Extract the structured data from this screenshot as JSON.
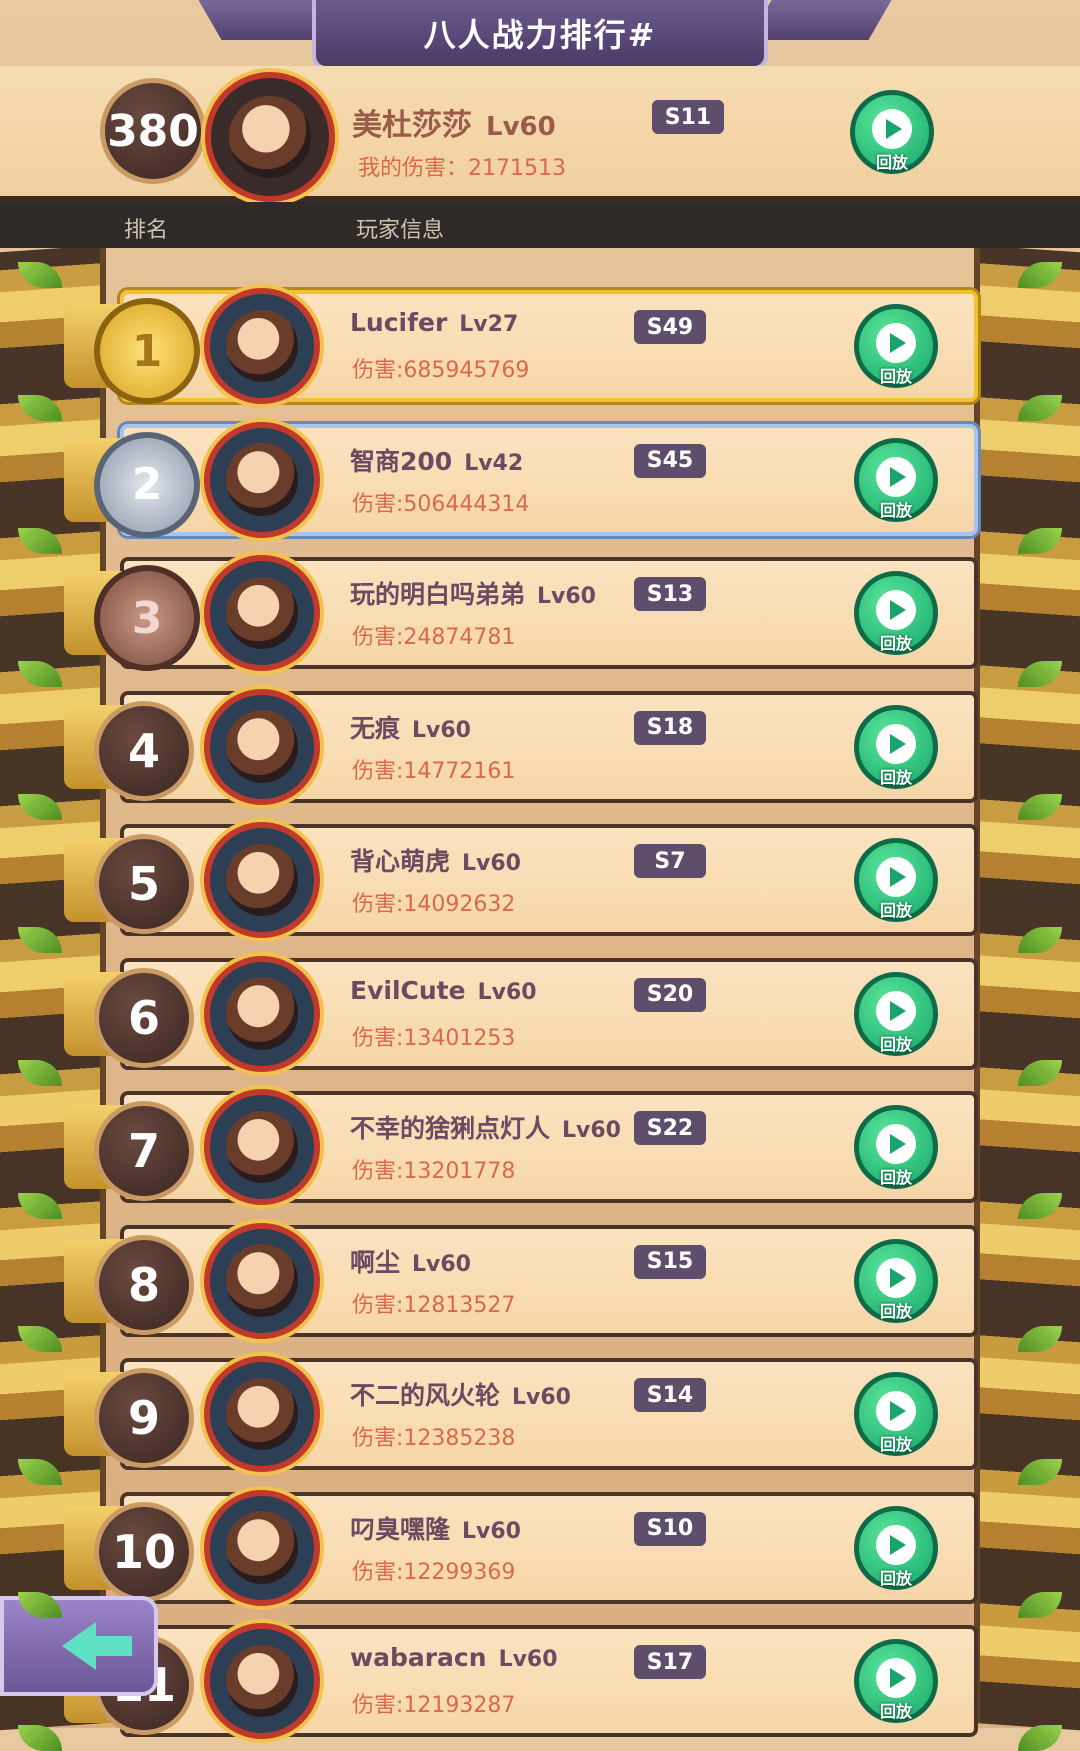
{
  "title": "八人战力排行#",
  "my_entry": {
    "rank": "380",
    "name": "美杜莎莎",
    "level": "Lv60",
    "server": "S11",
    "damage": "我的伤害：2171513",
    "replay_label": "回放"
  },
  "headers": {
    "rank": "排名",
    "player_info": "玩家信息"
  },
  "rows": [
    {
      "rank": "1",
      "name": "Lucifer",
      "level": "Lv27",
      "server": "S49",
      "damage": "伤害:685945769",
      "replay_label": "回放"
    },
    {
      "rank": "2",
      "name": "智商200",
      "level": "Lv42",
      "server": "S45",
      "damage": "伤害:506444314",
      "replay_label": "回放"
    },
    {
      "rank": "3",
      "name": "玩的明白吗弟弟",
      "level": "Lv60",
      "server": "S13",
      "damage": "伤害:24874781",
      "replay_label": "回放"
    },
    {
      "rank": "4",
      "name": "无痕",
      "level": "Lv60",
      "server": "S18",
      "damage": "伤害:14772161",
      "replay_label": "回放"
    },
    {
      "rank": "5",
      "name": "背心萌虎",
      "level": "Lv60",
      "server": "S7",
      "damage": "伤害:14092632",
      "replay_label": "回放"
    },
    {
      "rank": "6",
      "name": "EvilCute",
      "level": "Lv60",
      "server": "S20",
      "damage": "伤害:13401253",
      "replay_label": "回放"
    },
    {
      "rank": "7",
      "name": "不幸的猞猁点灯人",
      "level": "Lv60",
      "server": "S22",
      "damage": "伤害:13201778",
      "replay_label": "回放"
    },
    {
      "rank": "8",
      "name": "啊尘",
      "level": "Lv60",
      "server": "S15",
      "damage": "伤害:12813527",
      "replay_label": "回放"
    },
    {
      "rank": "9",
      "name": "不二的风火轮",
      "level": "Lv60",
      "server": "S14",
      "damage": "伤害:12385238",
      "replay_label": "回放"
    },
    {
      "rank": "10",
      "name": "叼臭嘿隆",
      "level": "Lv60",
      "server": "S10",
      "damage": "伤害:12299369",
      "replay_label": "回放"
    },
    {
      "rank": "11",
      "name": "wabaracn",
      "level": "Lv60",
      "server": "S17",
      "damage": "伤害:12193287",
      "replay_label": "回放"
    }
  ],
  "colors": {
    "server_badge": "#5e4e6c",
    "replay_button": "#16a86b",
    "damage_text": "#d9694b",
    "name_text": "#6b4a62",
    "gold_border": "#f2c232",
    "silver_border": "#a9c4ec"
  },
  "icons": {
    "replay": "play-circle-icon",
    "back": "arrow-left-icon",
    "rank_1": "gold-medal-icon",
    "rank_2": "silver-medal-icon",
    "rank_3": "bronze-medal-icon"
  }
}
